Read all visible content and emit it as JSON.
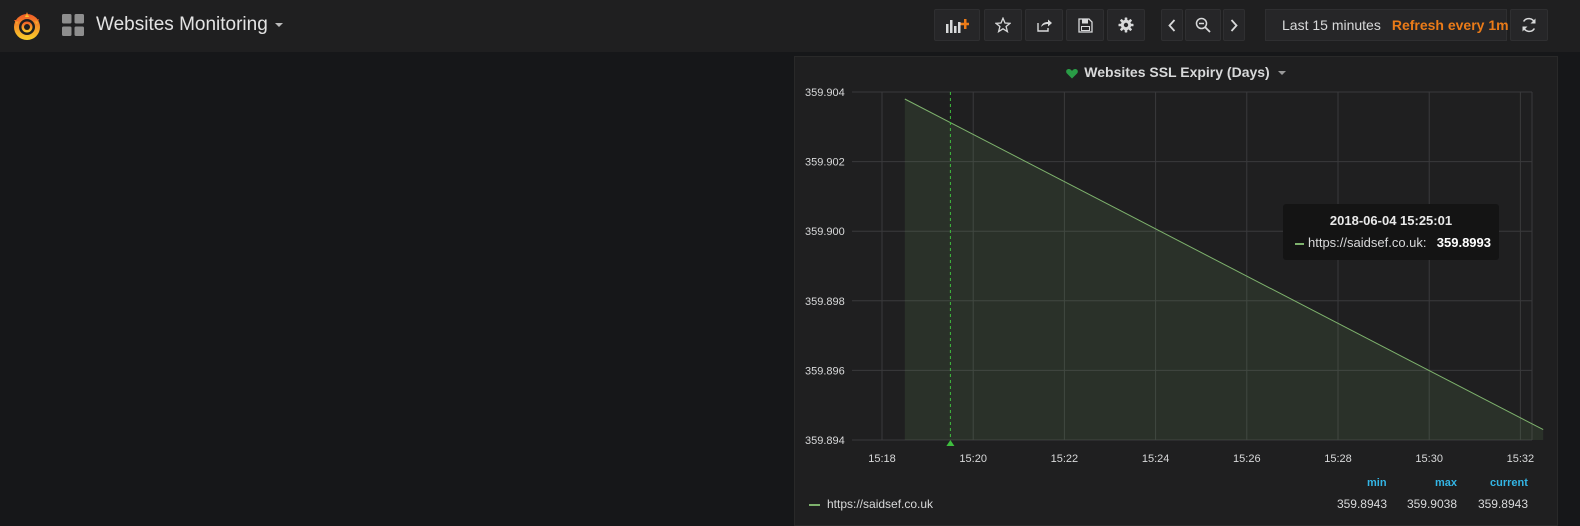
{
  "header": {
    "title": "Websites Monitoring",
    "time_range": "Last 15 minutes",
    "refresh": "Refresh every 1m",
    "buttons": [
      "add-panel-icon",
      "star-icon",
      "share-icon",
      "save-icon",
      "gear-icon",
      "chevron-left-icon",
      "zoom-out-icon",
      "chevron-right-icon",
      "clock-icon",
      "refresh-icon"
    ]
  },
  "panel": {
    "title": "Websites SSL Expiry (Days)",
    "status_icon": "heart-icon",
    "tooltip": {
      "time": "2018-06-04 15:25:01",
      "series": "https://saidsef.co.uk:",
      "value": "359.8993"
    },
    "legend": {
      "headers": [
        "min",
        "max",
        "current"
      ],
      "series": "https://saidsef.co.uk",
      "min": "359.8943",
      "max": "359.9038",
      "current": "359.8943"
    }
  },
  "colors": {
    "accent": "#eb7b18",
    "series": "#7eb26d",
    "legend_header": "#33b5e5",
    "background": "#161719"
  },
  "chart_data": {
    "type": "area",
    "title": "Websites SSL Expiry (Days)",
    "x": [
      "15:18:30",
      "15:32:30"
    ],
    "series": [
      {
        "name": "https://saidsef.co.uk",
        "x": [
          "15:18:30",
          "15:32:30"
        ],
        "values": [
          359.9038,
          359.8943
        ]
      }
    ],
    "x_ticks": [
      "15:18",
      "15:20",
      "15:22",
      "15:24",
      "15:26",
      "15:28",
      "15:30",
      "15:32"
    ],
    "y_ticks": [
      "359.894",
      "359.896",
      "359.898",
      "359.900",
      "359.902",
      "359.904"
    ],
    "ylim": [
      359.894,
      359.904
    ],
    "xlim": [
      "15:18",
      "15:32"
    ],
    "crosshair_time": "15:19:30",
    "grid": true,
    "legend": "bottom"
  }
}
